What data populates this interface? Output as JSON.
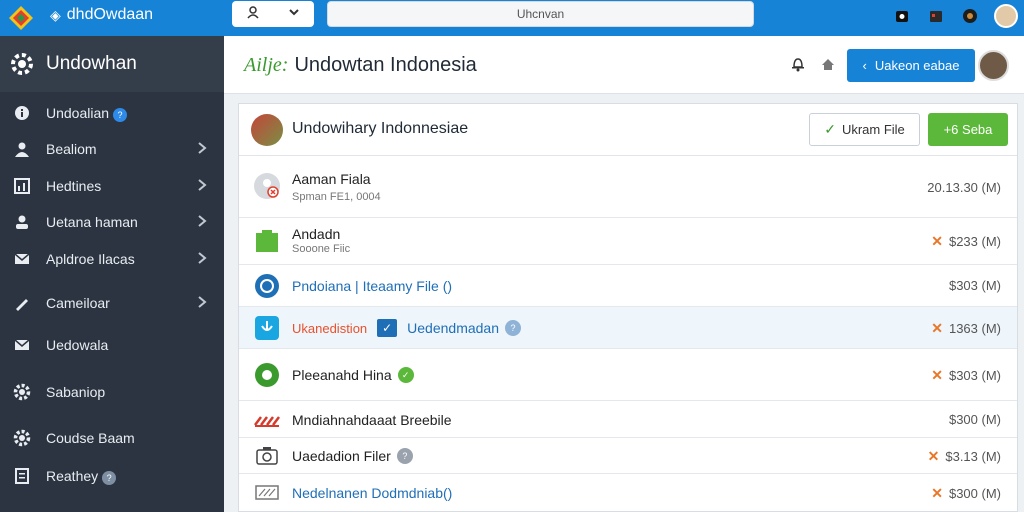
{
  "topbar": {
    "brand": "dhdOwdaan",
    "search_value": "Uhcnvan",
    "accent": "#1783d6"
  },
  "sidebar": {
    "header": "Undowhan",
    "items": [
      {
        "label": "Undoalian",
        "icon": "info-icon",
        "badge": "?",
        "chevron": false
      },
      {
        "label": "Bealiom",
        "icon": "user-icon",
        "chevron": true
      },
      {
        "label": "Hedtines",
        "icon": "chart-icon",
        "chevron": true
      },
      {
        "label": "Uetana haman",
        "icon": "person-icon",
        "chevron": true
      },
      {
        "label": "Apldroe Ilacas",
        "icon": "mail-icon",
        "chevron": true
      },
      {
        "label": "Cameiloar",
        "icon": "wrench-icon",
        "chevron": true
      },
      {
        "label": "Uedowala",
        "icon": "envelope-icon",
        "chevron": false
      },
      {
        "label": "Sabaniop",
        "icon": "gear-icon",
        "chevron": false
      },
      {
        "label": "Coudse Baam",
        "icon": "gear-icon",
        "chevron": false
      },
      {
        "label": "Reathey",
        "icon": "document-icon",
        "badge": "?",
        "chevron": false
      }
    ]
  },
  "header": {
    "prefix": "Ailje:",
    "title": "Undowtan Indonesia",
    "primary_button": "Uakeon eabae"
  },
  "panel": {
    "title": "Undowihary Indonnesiae",
    "outline_button": "Ukram File",
    "green_button": "+6 Seba",
    "rows": [
      {
        "name": "Aaman Fiala",
        "sub": "Spman FE1, 0004",
        "size": "20.13.30 (M)",
        "mark": "none"
      },
      {
        "name": "Andadn",
        "sub": "Sooone Fiic",
        "size": "$233 (M)",
        "mark": "x"
      },
      {
        "name": "Pndoiana | Iteaamy File ()",
        "sub": "",
        "size": "$303 (M)",
        "mark": "dl"
      },
      {
        "name": "Uedendmadan",
        "tag": "Ukanedistion",
        "sub": "",
        "size": "1363 (M)",
        "mark": "x"
      },
      {
        "name": "Pleeanahd Hina",
        "sub": "",
        "size": "$303 (M)",
        "mark": "x"
      },
      {
        "name": "Mndiahnahdaaat Breebile",
        "sub": "",
        "size": "$300 (M)",
        "mark": "dl"
      },
      {
        "name": "Uaedadion Filer",
        "sub": "",
        "size": "$3.13 (M)",
        "mark": "x"
      },
      {
        "name": "Nedelnanen Dodmdniab()",
        "sub": "",
        "size": "$300 (M)",
        "mark": "x"
      }
    ]
  }
}
